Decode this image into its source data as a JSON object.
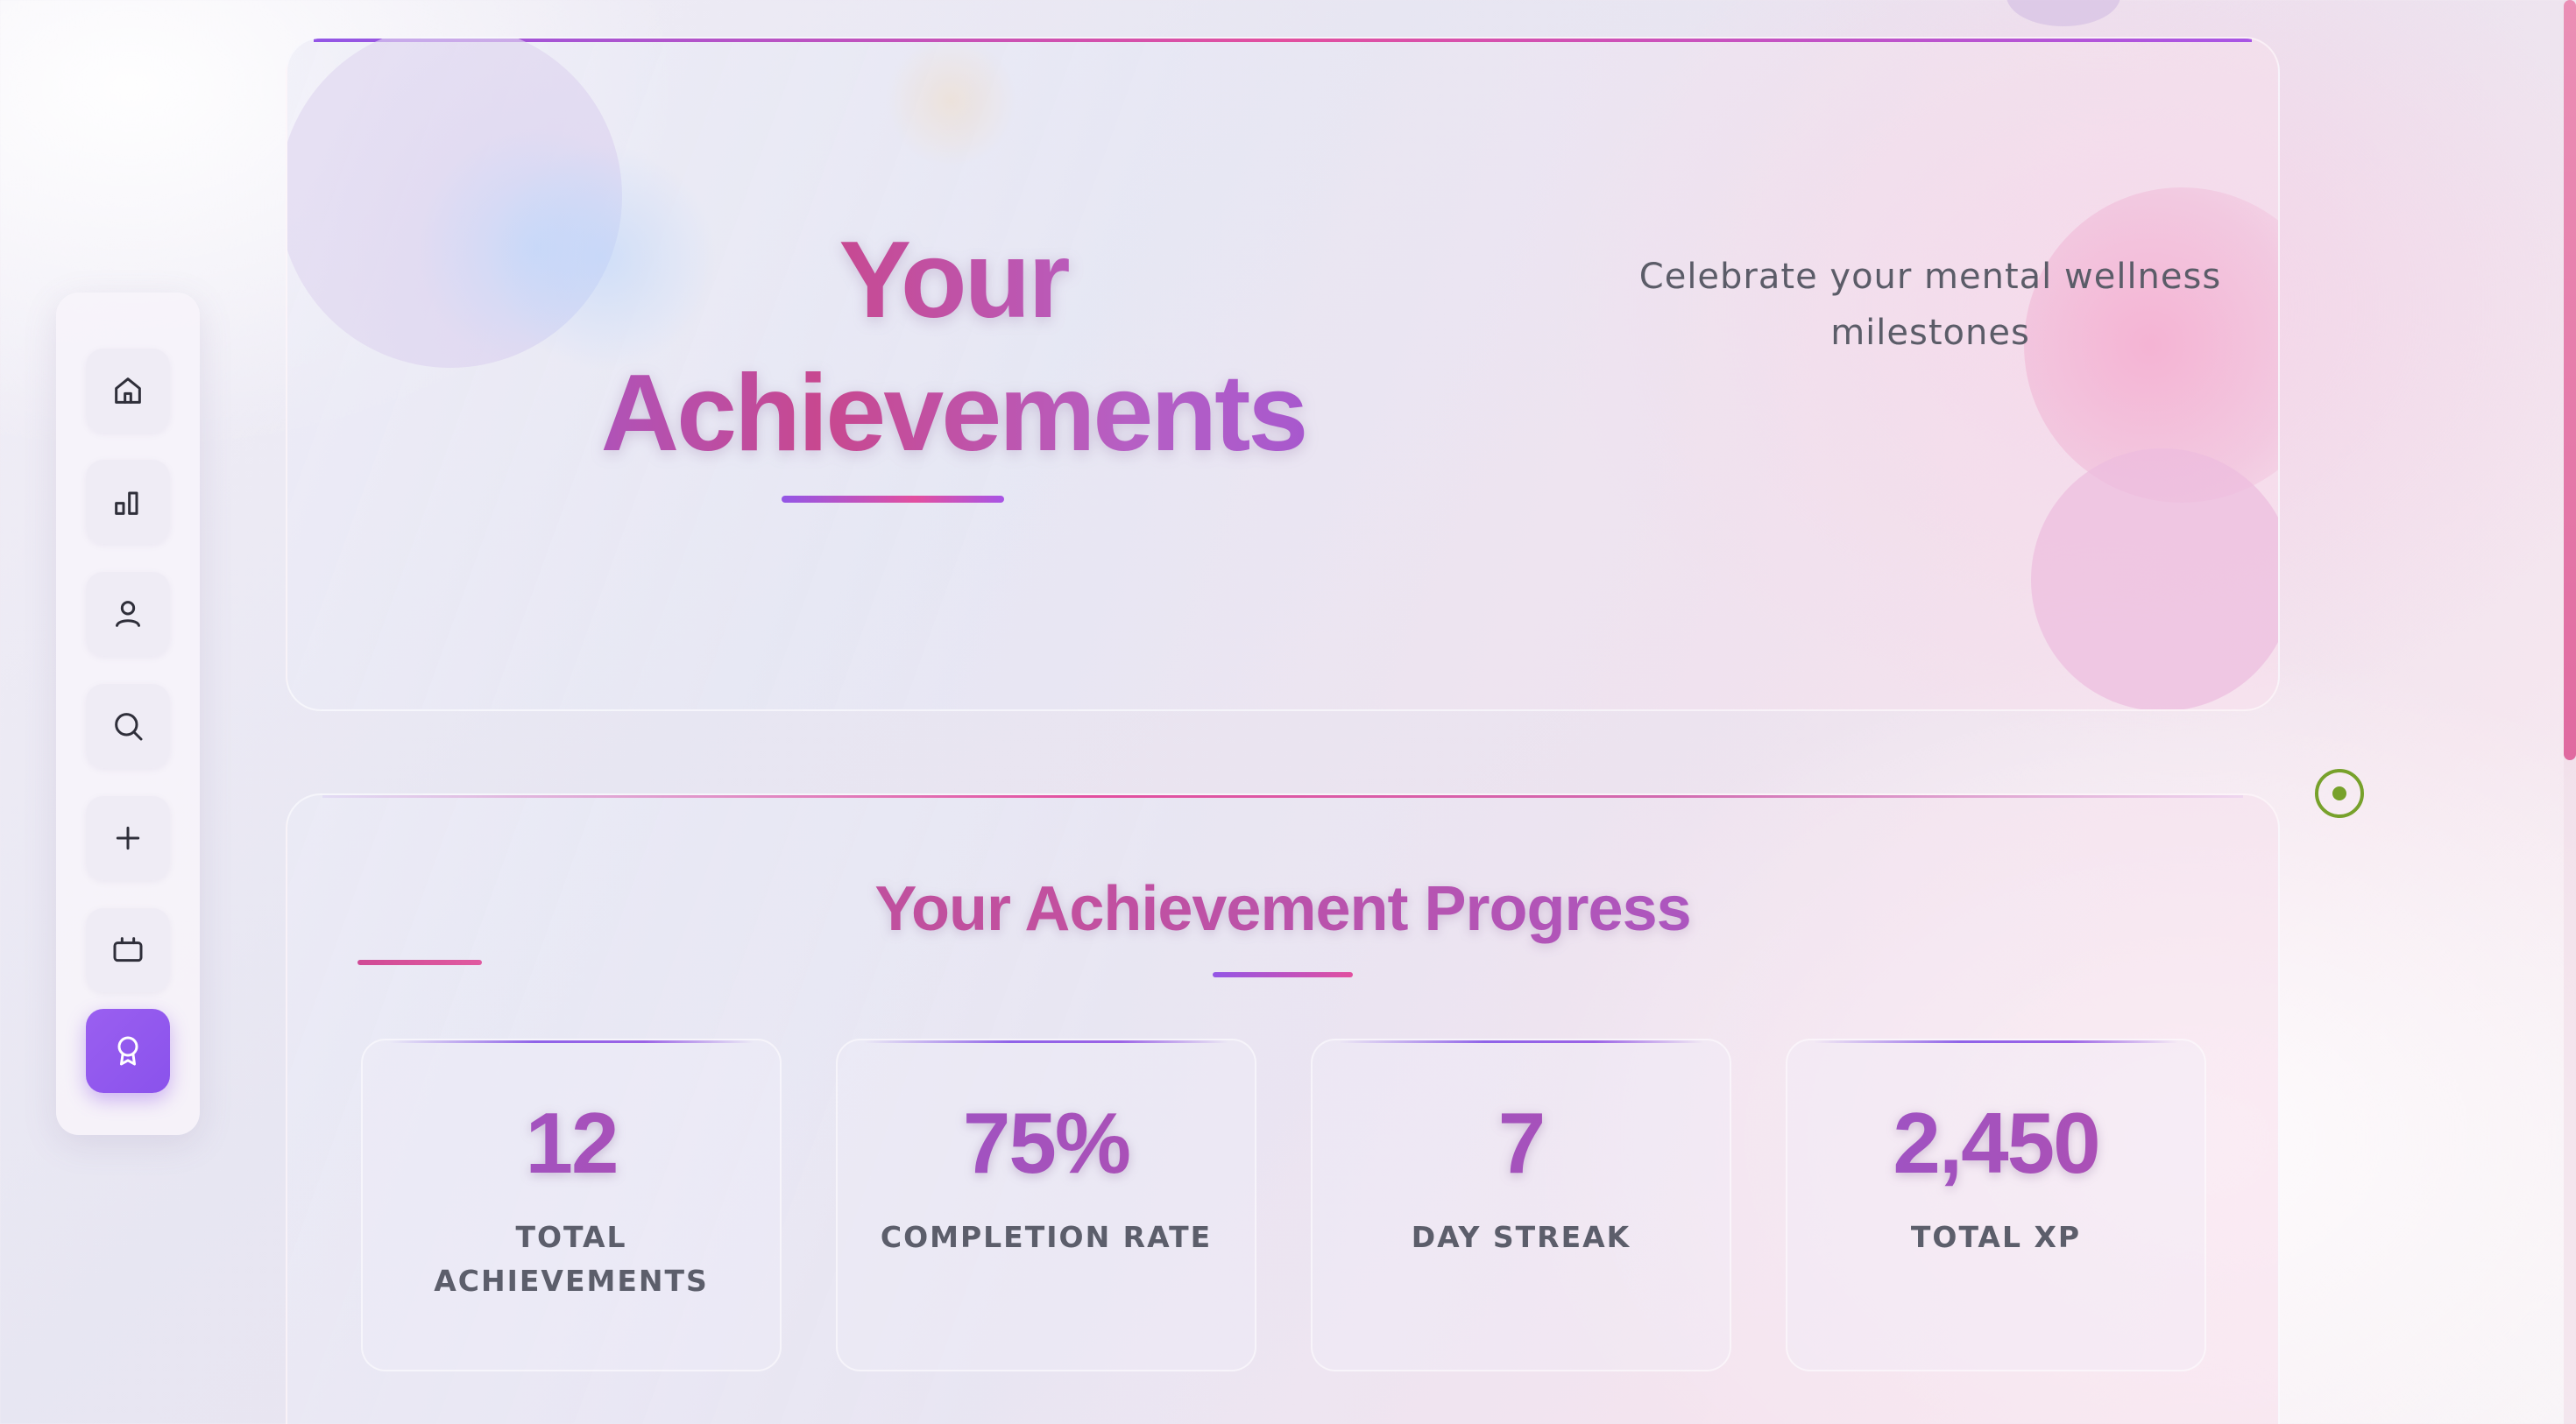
{
  "colors": {
    "accent_purple": "#9356e6",
    "accent_pink": "#e24f9f",
    "active_nav": "#8a52ec",
    "indicator_green": "#77a12b",
    "text_muted": "#5b5c68"
  },
  "sidebar": {
    "items": [
      {
        "icon": "home-icon",
        "active": false
      },
      {
        "icon": "bar-chart-icon",
        "active": false
      },
      {
        "icon": "user-icon",
        "active": false
      },
      {
        "icon": "search-icon",
        "active": false
      },
      {
        "icon": "plus-icon",
        "active": false
      },
      {
        "icon": "tv-icon",
        "active": false
      },
      {
        "icon": "award-icon",
        "active": true
      }
    ]
  },
  "hero": {
    "title_line1": "Your",
    "title_line2": "Achievements",
    "subtitle_line1": "Celebrate your mental wellness",
    "subtitle_line2": "milestones"
  },
  "progress": {
    "title": "Your Achievement Progress",
    "stats": [
      {
        "value": "12",
        "label": "Total Achievements"
      },
      {
        "value": "75%",
        "label": "Completion Rate"
      },
      {
        "value": "7",
        "label": "Day Streak"
      },
      {
        "value": "2,450",
        "label": "Total XP"
      }
    ]
  }
}
